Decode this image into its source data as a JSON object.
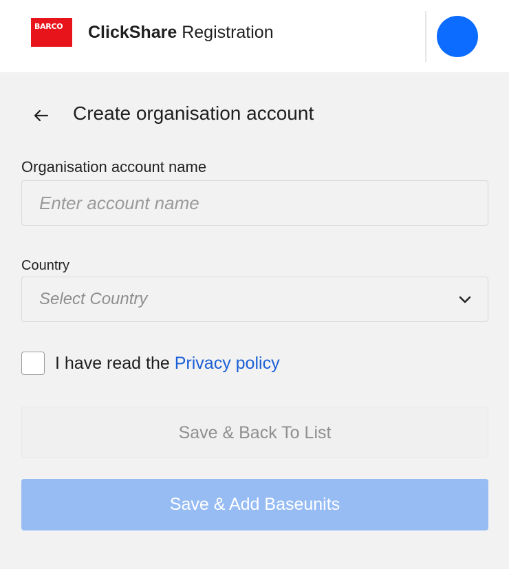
{
  "header": {
    "logo_text": "BARCO",
    "app_brand": "ClickShare",
    "app_suffix": "Registration",
    "colors": {
      "logo": "#e8141b",
      "avatar": "#0c6cff"
    }
  },
  "page": {
    "title": "Create organisation account",
    "back_icon": "arrow-left-icon"
  },
  "form": {
    "name_label": "Organisation account name",
    "name_placeholder": "Enter account name",
    "name_value": "",
    "country_label": "Country",
    "country_placeholder": "Select Country",
    "country_icon": "chevron-down-icon",
    "privacy_prefix": "I have read the",
    "privacy_link": "Privacy policy",
    "privacy_checked": false
  },
  "actions": {
    "save_back": "Save & Back To List",
    "save_add": "Save & Add Baseunits",
    "colors": {
      "primary_disabled": "#97bcf4",
      "link": "#1a5fd6"
    }
  }
}
